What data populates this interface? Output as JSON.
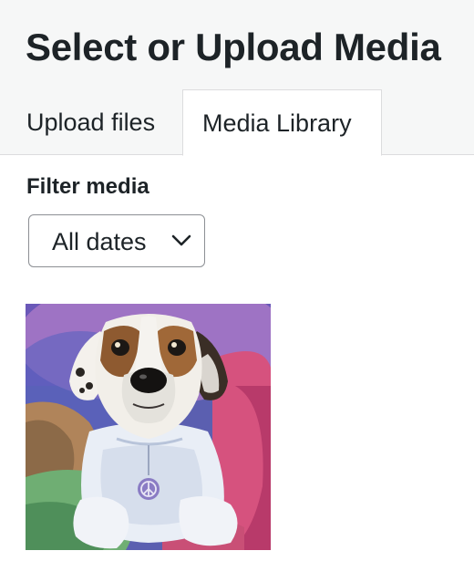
{
  "modal": {
    "title": "Select or Upload Media"
  },
  "tabs": [
    {
      "label": "Upload files",
      "active": false
    },
    {
      "label": "Media Library",
      "active": true
    }
  ],
  "filter": {
    "label": "Filter media",
    "date_select": {
      "selected": "All dates",
      "icon": "chevron-down-icon"
    }
  },
  "media_items": [
    {
      "type": "image",
      "subject": "painting of a dog with peace sign tag"
    }
  ],
  "colors": {
    "header_bg": "#f6f7f7",
    "border": "#dcdcde",
    "text": "#1d2327",
    "select_border": "#8c8f94"
  }
}
